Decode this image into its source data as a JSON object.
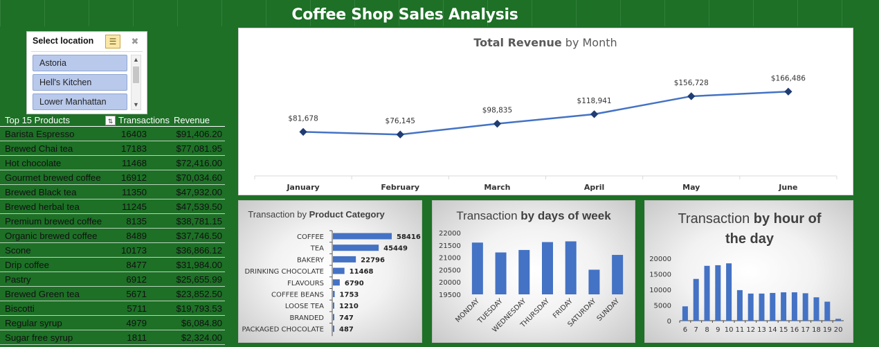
{
  "title": "Coffee Shop Sales Analysis",
  "slicer": {
    "header": "Select location",
    "items": [
      "Astoria",
      "Hell's Kitchen",
      "Lower Manhattan"
    ]
  },
  "table": {
    "header": {
      "name": "Top 15 Products",
      "transactions": "Transactions",
      "revenue": "Revenue"
    },
    "rows": [
      {
        "name": "Barista Espresso",
        "transactions": "16403",
        "revenue": "$91,406.20"
      },
      {
        "name": "Brewed Chai tea",
        "transactions": "17183",
        "revenue": "$77,081.95"
      },
      {
        "name": "Hot chocolate",
        "transactions": "11468",
        "revenue": "$72,416.00"
      },
      {
        "name": "Gourmet brewed coffee",
        "transactions": "16912",
        "revenue": "$70,034.60"
      },
      {
        "name": "Brewed Black tea",
        "transactions": "11350",
        "revenue": "$47,932.00"
      },
      {
        "name": "Brewed herbal tea",
        "transactions": "11245",
        "revenue": "$47,539.50"
      },
      {
        "name": "Premium brewed coffee",
        "transactions": "8135",
        "revenue": "$38,781.15"
      },
      {
        "name": "Organic brewed coffee",
        "transactions": "8489",
        "revenue": "$37,746.50"
      },
      {
        "name": "Scone",
        "transactions": "10173",
        "revenue": "$36,866.12"
      },
      {
        "name": "Drip coffee",
        "transactions": "8477",
        "revenue": "$31,984.00"
      },
      {
        "name": "Pastry",
        "transactions": "6912",
        "revenue": "$25,655.99"
      },
      {
        "name": "Brewed Green tea",
        "transactions": "5671",
        "revenue": "$23,852.50"
      },
      {
        "name": "Biscotti",
        "transactions": "5711",
        "revenue": "$19,793.53"
      },
      {
        "name": "Regular syrup",
        "transactions": "4979",
        "revenue": "$6,084.80"
      },
      {
        "name": "Sugar free syrup",
        "transactions": "1811",
        "revenue": "$2,324.00"
      }
    ]
  },
  "colors": {
    "background": "#1d7026",
    "accent": "#4472c4",
    "marker": "#1f3c73"
  },
  "chart_data": [
    {
      "type": "line",
      "title_bold": "Total Revenue",
      "title_rest": " by Month",
      "categories": [
        "January",
        "February",
        "March",
        "April",
        "May",
        "June"
      ],
      "values": [
        81678,
        76145,
        98835,
        118941,
        156728,
        166486
      ],
      "labels": [
        "$81,678",
        "$76,145",
        "$98,835",
        "$118,941",
        "$156,728",
        "$166,486"
      ],
      "ylim": [
        0,
        200000
      ],
      "grid": false
    },
    {
      "type": "bar",
      "orientation": "horizontal",
      "title_plain": "Transaction by ",
      "title_bold": "Product Category",
      "categories": [
        "COFFEE",
        "TEA",
        "BAKERY",
        "DRINKING CHOCOLATE",
        "FLAVOURS",
        "COFFEE BEANS",
        "LOOSE TEA",
        "BRANDED",
        "PACKAGED CHOCOLATE"
      ],
      "values": [
        58416,
        45449,
        22796,
        11468,
        6790,
        1753,
        1210,
        747,
        487
      ]
    },
    {
      "type": "bar",
      "title_plain": "Transaction ",
      "title_bold": "by days of week",
      "categories": [
        "MONDAY",
        "TUESDAY",
        "WEDNESDAY",
        "THURSDAY",
        "FRIDAY",
        "SATURDAY",
        "SUNDAY"
      ],
      "values": [
        21600,
        21200,
        21300,
        21620,
        21650,
        20500,
        21100
      ],
      "ylim": [
        19500,
        22000
      ],
      "yticks": [
        "22000",
        "21500",
        "21000",
        "20500",
        "20000",
        "19500"
      ],
      "ytick_values": [
        22000,
        21500,
        21000,
        20500,
        20000,
        19500
      ]
    },
    {
      "type": "bar",
      "title_plain": "Transaction ",
      "title_bold": "by hour of the day",
      "categories": [
        "6",
        "7",
        "8",
        "9",
        "10",
        "11",
        "12",
        "13",
        "14",
        "15",
        "16",
        "17",
        "18",
        "19",
        "20"
      ],
      "values": [
        4600,
        13400,
        17600,
        17800,
        18400,
        9800,
        8700,
        8700,
        8900,
        9100,
        9100,
        8800,
        7500,
        6100,
        600
      ],
      "ylim": [
        0,
        20000
      ],
      "yticks": [
        "20000",
        "15000",
        "10000",
        "5000",
        "0"
      ],
      "ytick_values": [
        20000,
        15000,
        10000,
        5000,
        0
      ]
    }
  ]
}
